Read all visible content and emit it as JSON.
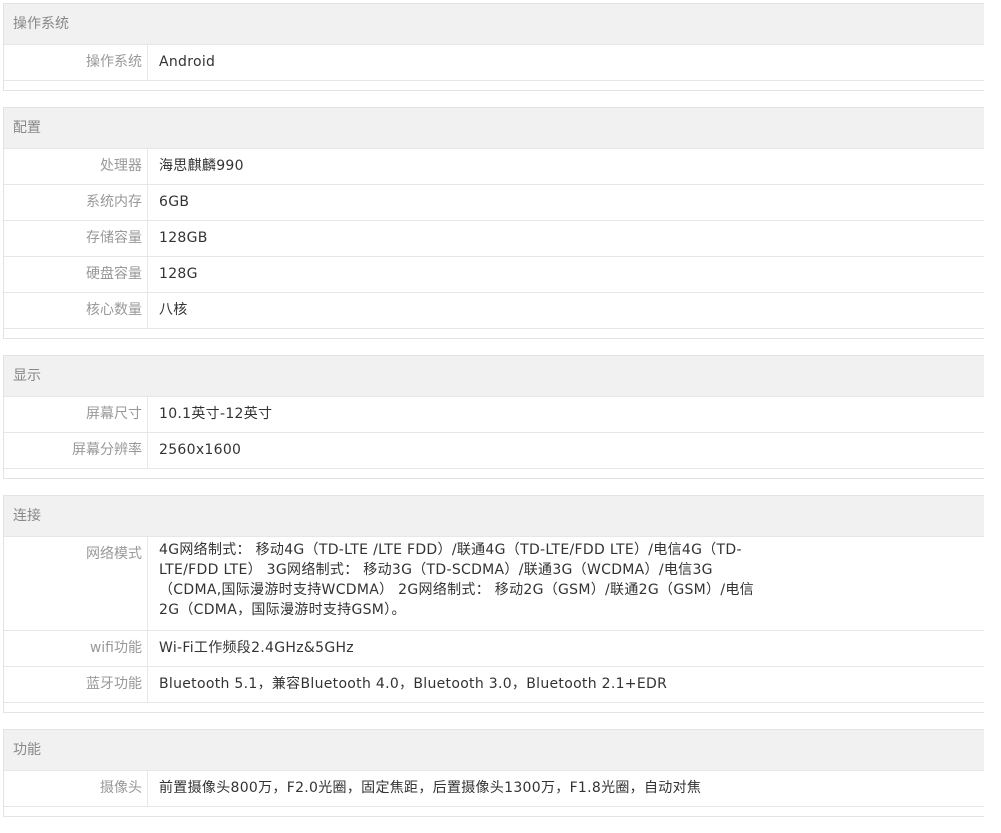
{
  "sections": [
    {
      "title": "操作系统",
      "rows": [
        {
          "label": "操作系统",
          "value": "Android"
        }
      ]
    },
    {
      "title": "配置",
      "rows": [
        {
          "label": "处理器",
          "value": "海思麒麟990"
        },
        {
          "label": "系统内存",
          "value": "6GB"
        },
        {
          "label": "存储容量",
          "value": "128GB"
        },
        {
          "label": "硬盘容量",
          "value": "128G"
        },
        {
          "label": "核心数量",
          "value": "八核"
        }
      ]
    },
    {
      "title": "显示",
      "rows": [
        {
          "label": "屏幕尺寸",
          "value": "10.1英寸-12英寸"
        },
        {
          "label": "屏幕分辨率",
          "value": "2560x1600"
        }
      ]
    },
    {
      "title": "连接",
      "rows": [
        {
          "label": "网络模式",
          "value": "4G网络制式： 移动4G（TD-LTE /LTE FDD）/联通4G（TD-LTE/FDD LTE）/电信4G（TD-LTE/FDD LTE） 3G网络制式： 移动3G（TD-SCDMA）/联通3G（WCDMA）/电信3G（CDMA,国际漫游时支持WCDMA） 2G网络制式： 移动2G（GSM）/联通2G（GSM）/电信2G（CDMA，国际漫游时支持GSM）。"
        },
        {
          "label": "wifi功能",
          "value": "Wi-Fi工作频段2.4GHz&5GHz"
        },
        {
          "label": "蓝牙功能",
          "value": "Bluetooth 5.1，兼容Bluetooth 4.0，Bluetooth 3.0，Bluetooth 2.1+EDR"
        }
      ]
    },
    {
      "title": "功能",
      "rows": [
        {
          "label": "摄像头",
          "value": "前置摄像头800万，F2.0光圈，固定焦距，后置摄像头1300万，F1.8光圈，自动对焦"
        }
      ]
    }
  ]
}
